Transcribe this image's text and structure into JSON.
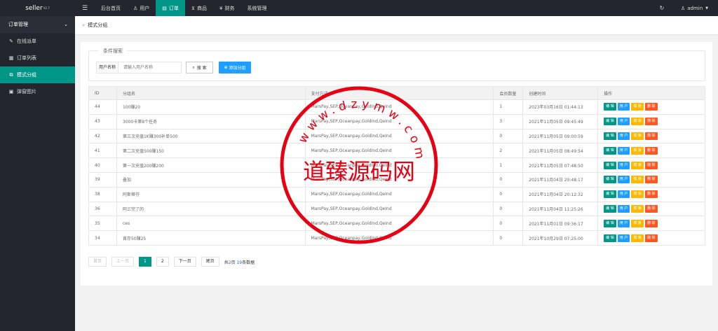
{
  "app": {
    "logo": "seller",
    "version": "V2.7"
  },
  "topnav": {
    "menu_icon": "hamburger-icon",
    "items": [
      {
        "label": "后台首页",
        "icon": "",
        "active": false
      },
      {
        "label": "用户",
        "icon": "user-icon",
        "active": false
      },
      {
        "label": "订单",
        "icon": "document-icon",
        "active": true
      },
      {
        "label": "商品",
        "icon": "cart-icon",
        "active": false
      },
      {
        "label": "财务",
        "icon": "yen-icon",
        "active": false
      },
      {
        "label": "系统管理",
        "icon": "",
        "active": false
      }
    ],
    "user": "admin"
  },
  "sidebar": {
    "group": "订单管理",
    "items": [
      {
        "label": "在线派单",
        "icon": "edit-icon",
        "active": false
      },
      {
        "label": "订单列表",
        "icon": "list-icon",
        "active": false
      },
      {
        "label": "模式分组",
        "icon": "group-icon",
        "active": true
      },
      {
        "label": "弹窗图片",
        "icon": "image-icon",
        "active": false
      }
    ]
  },
  "breadcrumb": {
    "sep": "»",
    "current": "模式分组"
  },
  "search": {
    "legend": "条件搜索",
    "label": "用户名称",
    "placeholder": "请输入用户名称",
    "search_button": "搜 索",
    "add_button": "添加分组"
  },
  "table": {
    "headers": [
      "ID",
      "分组名",
      "支付方式",
      "会员数量",
      "创建时间",
      "操作"
    ],
    "actions": [
      "编 辑",
      "用 户",
      "模 板",
      "删 除"
    ],
    "rows": [
      {
        "id": "44",
        "name": "100赚20",
        "pay": "MarsPay,SEP,Oceanpay,GoldInd,QeInd",
        "count": "1",
        "created": "2023年03月16日 01:44:13"
      },
      {
        "id": "43",
        "name": "3000卡第8个任务",
        "pay": "MarsPay,SEP,Oceanpay,GoldInd,QeInd",
        "count": "3",
        "created": "2021年11月05日 09:45:49"
      },
      {
        "id": "42",
        "name": "第三次充值1K赚300补单500",
        "pay": "MarsPay,SEP,Oceanpay,GoldInd,QeInd",
        "count": "0",
        "created": "2021年11月05日 09:00:59"
      },
      {
        "id": "41",
        "name": "第二次充值500赚150",
        "pay": "MarsPay,SEP,Oceanpay,GoldInd,QeInd",
        "count": "2",
        "created": "2021年11月05日 08:49:54"
      },
      {
        "id": "40",
        "name": "第一次充值200赚200",
        "pay": "MarsPay,SEP,Oceanpay,GoldInd,QeInd",
        "count": "1",
        "created": "2021年11月05日 07:48:50"
      },
      {
        "id": "39",
        "name": "叠加",
        "pay": "MarsPay,SEP,Oceanpay,GoldInd,QeInd",
        "count": "0",
        "created": "2021年11月04日 20:48:17"
      },
      {
        "id": "38",
        "name": "阿斯蒂芬",
        "pay": "MarsPay,SEP,Oceanpay,GoldInd,QeInd",
        "count": "0",
        "created": "2021年11月04日 20:12:32"
      },
      {
        "id": "36",
        "name": "阿三完了的",
        "pay": "MarsPay,SEP,Oceanpay,GoldInd,QeInd",
        "count": "0",
        "created": "2021年11月04日 11:25:26"
      },
      {
        "id": "35",
        "name": "ces",
        "pay": "MarsPay,SEP,Oceanpay,GoldInd,QeInd",
        "count": "0",
        "created": "2021年11月01日 09:36:17"
      },
      {
        "id": "34",
        "name": "首存50赚25",
        "pay": "MarsPay,SEP,Oceanpay,GoldInd,QeInd",
        "count": "0",
        "created": "2021年10月29日 07:25:00"
      }
    ]
  },
  "pager": {
    "first": "首页",
    "prev": "上一页",
    "pages": [
      "1",
      "2"
    ],
    "current": "1",
    "next": "下一页",
    "last": "尾页",
    "info_prefix": "共",
    "total_pages": "2",
    "info_mid": "页 ",
    "total_records": "19",
    "info_suffix": "条数据"
  },
  "watermark": {
    "text": "道臻源码网",
    "ring_text": "www.dzymw.com"
  },
  "colors": {
    "accent": "#009688",
    "blue": "#1e9fff",
    "yellow": "#ffb800",
    "orange": "#ff5722",
    "dark": "#23262e",
    "stamp": "#e60012"
  }
}
